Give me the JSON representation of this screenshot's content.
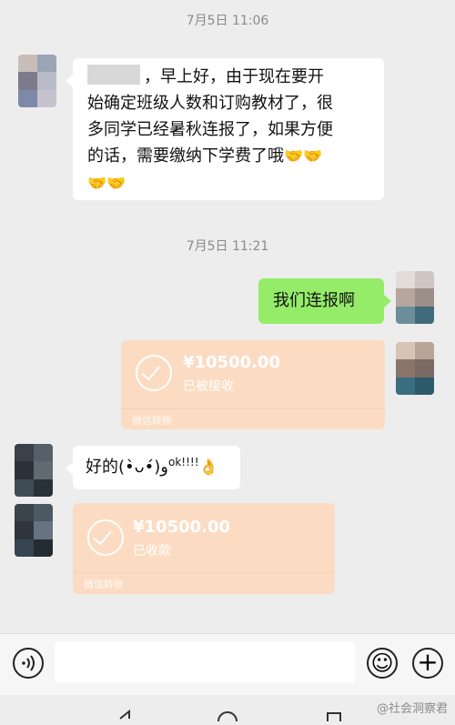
{
  "chat": {
    "timestamps": [
      "7月5日 11:06",
      "7月5日 11:21"
    ],
    "messages": [
      {
        "side": "left",
        "text_line1": "，早上好，由于现在要开",
        "text_line2": "始确定班级人数和订购教材了，很",
        "text_line3": "多同学已经暑秋连报了，如果方便",
        "text_line4": "的话，需要缴纳下学费了哦",
        "emojis_line4": "🤝🤝",
        "emojis_line5": "🤝🤝"
      },
      {
        "side": "right",
        "text": "我们连报啊"
      },
      {
        "side": "right",
        "type": "transfer",
        "amount": "¥10500.00",
        "status": "已被接收",
        "footer": "微信转账"
      },
      {
        "side": "left",
        "text": "好的(•̀ᴗ•́)و",
        "ok": "ok!!!!",
        "emoji": "👌"
      },
      {
        "side": "left",
        "type": "transfer",
        "amount": "¥10500.00",
        "status": "已收款",
        "footer": "微信转账"
      }
    ]
  },
  "inputbar": {
    "voice_icon": "voice-icon",
    "emoji_icon": "emoji-icon",
    "plus_icon": "plus-icon",
    "emoji_glyph": "☺",
    "plus_glyph": "+"
  },
  "watermark": "@社会洞察君",
  "colors": {
    "background": "#ededed",
    "bubble_green": "#95ec69",
    "transfer_bg": "#fbdcc3"
  }
}
